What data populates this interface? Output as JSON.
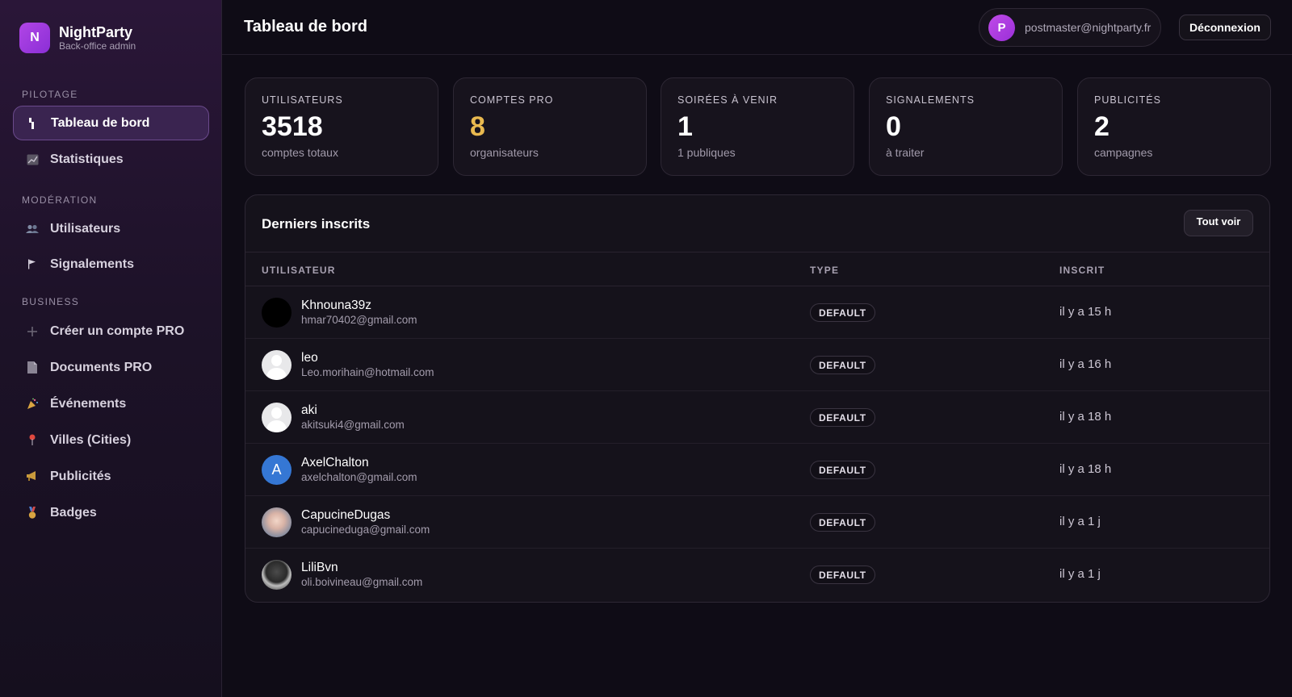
{
  "brand": {
    "logo_letter": "N",
    "name": "NightParty",
    "subtitle": "Back-office admin"
  },
  "sidebar": {
    "sections": [
      {
        "label": "PILOTAGE",
        "items": [
          {
            "label": "Tableau de bord",
            "icon": "dashboard-icon",
            "active": true
          },
          {
            "label": "Statistiques",
            "icon": "chart-icon"
          }
        ]
      },
      {
        "label": "MODÉRATION",
        "items": [
          {
            "label": "Utilisateurs",
            "icon": "users-icon"
          },
          {
            "label": "Signalements",
            "icon": "flag-icon"
          }
        ]
      },
      {
        "label": "BUSINESS",
        "items": [
          {
            "label": "Créer un compte PRO",
            "icon": "plus-icon"
          },
          {
            "label": "Documents PRO",
            "icon": "document-icon"
          },
          {
            "label": "Événements",
            "icon": "party-icon"
          },
          {
            "label": "Villes (Cities)",
            "icon": "pin-icon"
          },
          {
            "label": "Publicités",
            "icon": "megaphone-icon"
          },
          {
            "label": "Badges",
            "icon": "medal-icon"
          }
        ]
      }
    ]
  },
  "header": {
    "title": "Tableau de bord",
    "user_initial": "P",
    "user_email": "postmaster@nightparty.fr",
    "logout_label": "Déconnexion"
  },
  "stats": [
    {
      "label": "UTILISATEURS",
      "value": "3518",
      "sub": "comptes totaux"
    },
    {
      "label": "COMPTES PRO",
      "value": "8",
      "sub": "organisateurs"
    },
    {
      "label": "SOIRÉES À VENIR",
      "value": "1",
      "sub": "1 publiques"
    },
    {
      "label": "SIGNALEMENTS",
      "value": "0",
      "sub": "à traiter"
    },
    {
      "label": "PUBLICITÉS",
      "value": "2",
      "sub": "campagnes"
    }
  ],
  "recent": {
    "title": "Derniers inscrits",
    "see_all_label": "Tout voir",
    "columns": [
      "UTILISATEUR",
      "TYPE",
      "INSCRIT"
    ],
    "rows": [
      {
        "name": "Khnouna39z",
        "email": "hmar70402@gmail.com",
        "type": "DEFAULT",
        "joined": "il y a 15 h"
      },
      {
        "name": "leo",
        "email": "Leo.morihain@hotmail.com",
        "type": "DEFAULT",
        "joined": "il y a 16 h"
      },
      {
        "name": "aki",
        "email": "akitsuki4@gmail.com",
        "type": "DEFAULT",
        "joined": "il y a 18 h"
      },
      {
        "name": "AxelChalton",
        "email": "axelchalton@gmail.com",
        "type": "DEFAULT",
        "joined": "il y a 18 h",
        "avatar_letter": "A"
      },
      {
        "name": "CapucineDugas",
        "email": "capucineduga@gmail.com",
        "type": "DEFAULT",
        "joined": "il y a 1 j"
      },
      {
        "name": "LiliBvn",
        "email": "oli.boivineau@gmail.com",
        "type": "DEFAULT",
        "joined": "il y a 1 j"
      }
    ]
  },
  "colors": {
    "accent": "#a63de0",
    "pro_value": "#e9b94f",
    "active_nav": "#3a2450"
  }
}
